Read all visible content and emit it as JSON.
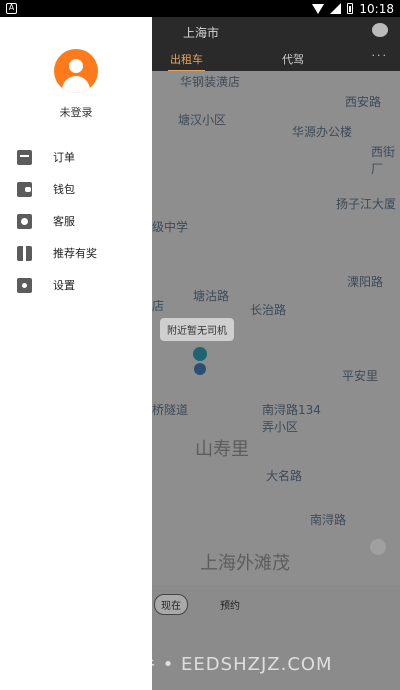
{
  "status_bar": {
    "time": "10:18"
  },
  "header": {
    "city": "上海市"
  },
  "tabs": {
    "taxi": "出租车",
    "designated_driver": "代驾",
    "more": "···"
  },
  "map": {
    "labels": [
      "华钢装潢店",
      "西安路",
      "塘汉小区",
      "华源办公楼",
      "西街厂",
      "扬子江大厦",
      "级中学",
      "溧阳路",
      "塘沽路",
      "长治路",
      "平安里",
      "南浔路134弄小区",
      "山寿里",
      "大名路",
      "南浔路",
      "上海外滩茂",
      "店",
      "桥隧道"
    ],
    "bubble": "附近暂无司机"
  },
  "booking": {
    "now": "现在",
    "reserve": "预约"
  },
  "drawer": {
    "login_status": "未登录",
    "menu": [
      {
        "label": "订单",
        "icon": "order-icon"
      },
      {
        "label": "钱包",
        "icon": "wallet-icon"
      },
      {
        "label": "客服",
        "icon": "customer-service-icon"
      },
      {
        "label": "推荐有奖",
        "icon": "gift-icon"
      },
      {
        "label": "设置",
        "icon": "gear-icon"
      }
    ]
  },
  "watermark": "易享助手 • EEDSHZJZ.COM",
  "colors": {
    "accent": "#ff7a1a",
    "tab_active": "#e8a35a"
  }
}
